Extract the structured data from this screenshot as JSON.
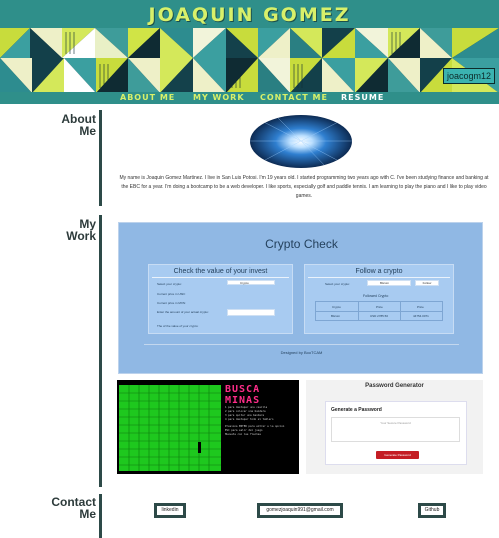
{
  "header": {
    "title": "JOAQUIN GOMEZ",
    "handle": "joacogm12"
  },
  "nav": {
    "items": [
      {
        "label": "ABOUT ME"
      },
      {
        "label": "MY WORK"
      },
      {
        "label": "CONTACT ME"
      },
      {
        "label": "RESUME"
      }
    ]
  },
  "about": {
    "label_line1": "About",
    "label_line2": "Me",
    "text": "My name is Joaquin Gomez Martinez. I live in San Luis Potosi. I'm 19 years old. I started programming two years ago with C. I've been studying finance and banking at the EBC for a year. I'm doing a bootcamp to be a web developer. I like sports, especially golf and paddle tennis. I am learning to play the piano and I like to play video games."
  },
  "work": {
    "label_line1": "My",
    "label_line2": "Work",
    "crypto": {
      "title": "Crypto Check",
      "left_panel_title": "Check the value of your invest",
      "right_panel_title": "Follow a crypto",
      "rows_left": [
        "Select your crypto:",
        "Current price in USD:",
        "Current price in MXN:",
        "Enter the amount of your actual crypto:",
        "The of the value of your crypto:"
      ],
      "select_value": "Crypto",
      "right_select_label": "Select your crypto:",
      "right_select_value": "Bitcoin",
      "right_button": "Follow",
      "followed_title": "Followed Crypto",
      "table_headers": [
        "Crypto",
        "Price",
        "Price"
      ],
      "table_row": [
        "Bitcoin",
        "USD 2785.50",
        "44754.0071"
      ],
      "footer": "Designed by BooTCAM"
    },
    "mines": {
      "title": "BUSCA MINAS",
      "lines": [
        "1 para destapar una casilla",
        "2 para colocar una bandera",
        "3 para quitar una bandera",
        "4 para destapar todo el tablero",
        "Presiona ENTER para entrar a la opcion",
        "ESC para salir del juego",
        "Muevete con las flechas"
      ]
    },
    "password": {
      "title": "Password Generator",
      "subtitle": "Generate a Password",
      "placeholder": "Your Secure Password",
      "button": "Generate Password"
    }
  },
  "contact": {
    "label_line1": "Contact",
    "label_line2": "Me",
    "links": [
      {
        "label": "linkedin"
      },
      {
        "label": "gomezjoaquin991@gmail.com"
      },
      {
        "label": "Github"
      }
    ]
  },
  "colors": {
    "header_teal": "#2f8f8a",
    "lime": "#d8f06a",
    "divider": "#2d4a48",
    "crypto_bg": "#90b8e4",
    "mines_green": "#1ec81e",
    "generate_red": "#c41d24"
  }
}
